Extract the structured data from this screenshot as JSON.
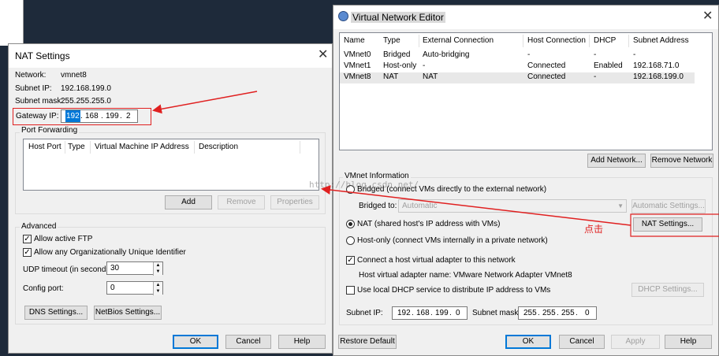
{
  "colors": {
    "arrow": "#e02020",
    "selection": "#0078d7",
    "desktop": "#1e2a3a"
  },
  "nat": {
    "title": "NAT Settings",
    "network_label": "Network:",
    "network_value": "vmnet8",
    "subnet_ip_label": "Subnet IP:",
    "subnet_ip_value": "192.168.199.0",
    "subnet_mask_label": "Subnet mask:",
    "subnet_mask_value": "255.255.255.0",
    "gateway_label": "Gateway IP:",
    "gateway_octets": [
      "192",
      "168",
      "199",
      "2"
    ],
    "port_forwarding": {
      "legend": "Port Forwarding",
      "headers": [
        "Host Port",
        "Type",
        "Virtual Machine IP Address",
        "Description"
      ],
      "add": "Add",
      "remove": "Remove",
      "properties": "Properties"
    },
    "advanced": {
      "legend": "Advanced",
      "allow_ftp": "Allow active FTP",
      "allow_oui": "Allow any Organizationally Unique Identifier",
      "udp_label": "UDP timeout (in seconds):",
      "udp_value": "30",
      "config_port_label": "Config port:",
      "config_port_value": "0",
      "dns": "DNS Settings...",
      "netbios": "NetBios Settings..."
    },
    "ok": "OK",
    "cancel": "Cancel",
    "help": "Help"
  },
  "vne": {
    "title": "Virtual Network Editor",
    "headers": [
      "Name",
      "Type",
      "External Connection",
      "Host Connection",
      "DHCP",
      "Subnet Address"
    ],
    "rows": [
      [
        "VMnet0",
        "Bridged",
        "Auto-bridging",
        "-",
        "-",
        "-"
      ],
      [
        "VMnet1",
        "Host-only",
        "-",
        "Connected",
        "Enabled",
        "192.168.71.0"
      ],
      [
        "VMnet8",
        "NAT",
        "NAT",
        "Connected",
        "-",
        "192.168.199.0"
      ]
    ],
    "add_network": "Add Network...",
    "remove_network": "Remove Network",
    "info": {
      "legend": "VMnet Information",
      "bridged": "Bridged (connect VMs directly to the external network)",
      "bridged_to_label": "Bridged to:",
      "bridged_to_value": "Automatic",
      "auto_settings": "Automatic Settings...",
      "nat": "NAT (shared host's IP address with VMs)",
      "nat_settings": "NAT Settings...",
      "hostonly": "Host-only (connect VMs internally in a private network)",
      "connect_adapter": "Connect a host virtual adapter to this network",
      "adapter_name": "Host virtual adapter name: VMware Network Adapter VMnet8",
      "use_dhcp": "Use local DHCP service to distribute IP address to VMs",
      "dhcp_settings": "DHCP Settings...",
      "subnet_ip_label": "Subnet IP:",
      "subnet_ip_octets": [
        "192",
        "168",
        "199",
        "0"
      ],
      "subnet_mask_label": "Subnet mask:",
      "subnet_mask_octets": [
        "255",
        "255",
        "255",
        "0"
      ]
    },
    "restore": "Restore Default",
    "ok": "OK",
    "cancel": "Cancel",
    "apply": "Apply",
    "help": "Help"
  },
  "annotation": {
    "click_text": "点击",
    "watermark": "http://blog.csdn.net/"
  }
}
